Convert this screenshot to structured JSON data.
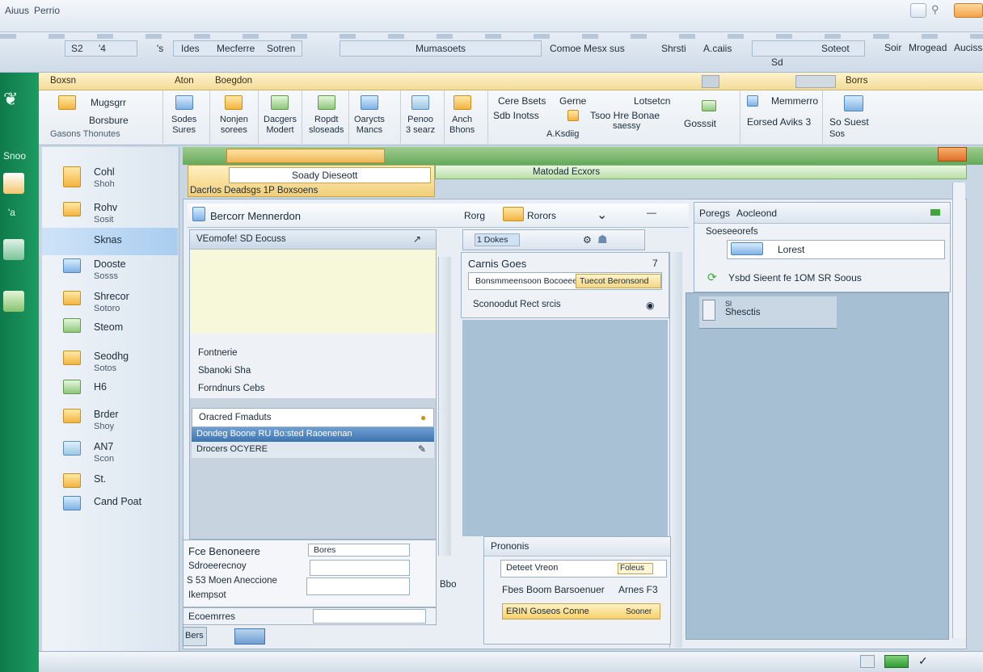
{
  "titlebar": {
    "items": [
      "Aiuus",
      "Perrio"
    ]
  },
  "menu": {
    "items": [
      "S2",
      "'4",
      "'s",
      "Ides",
      "Mecferre",
      "Sotren",
      "Mumasoets",
      "Comoe Mesx sus",
      "Shrsti",
      "A.caiis",
      "Sd",
      "Soteot",
      "Soir",
      "Mrogead",
      "Auciss"
    ]
  },
  "ribbon": {
    "tabs": [
      "Boxsn",
      "Aton",
      "Boegdon",
      "Borrs"
    ],
    "groups": [
      {
        "label": "Mugsgrr",
        "sub": "Borsbure",
        "foot": "Gasons   Thonutes"
      },
      {
        "label": "Sodes",
        "sub": "Sures"
      },
      {
        "label": "Nonjen",
        "sub": "sorees"
      },
      {
        "label": "Dacgers",
        "sub": "Modert"
      },
      {
        "label": "Ropdt",
        "sub": "sloseads"
      },
      {
        "label": "Oarycts",
        "sub": "Mancs"
      },
      {
        "label": "Penoo",
        "sub": "3 searz"
      },
      {
        "label": "Anch",
        "sub": "Bhons"
      },
      {
        "label": "Cere Bsets",
        "sub": "Sdb Inotss"
      },
      {
        "label": "Gerne",
        "sub": "Tsoo Hre Bonae"
      },
      {
        "label": "Lotsetcn",
        "sub": "saessy"
      },
      {
        "label": "Gosssit",
        "sub": "A.Ksdiig"
      },
      {
        "label": "Memmerro",
        "sub": "Eorsed Aviks 3"
      },
      {
        "label": "So Suest",
        "sub": "Sos"
      }
    ]
  },
  "rail": {
    "labels": [
      "Snoo",
      "'a"
    ]
  },
  "nav": {
    "items": [
      {
        "l1": "Cohl",
        "l2": "Shoh"
      },
      {
        "l1": "Rohv",
        "l2": "Sosit"
      },
      {
        "l1": "Sknas",
        "l2": ""
      },
      {
        "l1": "Dooste",
        "l2": "Sosss"
      },
      {
        "l1": "Shrecor",
        "l2": "Sotoro"
      },
      {
        "l1": "Steom",
        "l2": ""
      },
      {
        "l1": "Seodhg",
        "l2": "Sotos"
      },
      {
        "l1": "H6",
        "l2": ""
      },
      {
        "l1": "Brder",
        "l2": "Shoy"
      },
      {
        "l1": "AN7",
        "l2": "Scon"
      },
      {
        "l1": "St.",
        "l2": ""
      },
      {
        "l1": "Cand Poat",
        "l2": ""
      }
    ]
  },
  "doc": {
    "tab1": "Soady Dieseott",
    "tab2": "Matodad Ecxors",
    "yellowbar": "Dacrlos Deadsgs 1P Boxsoens",
    "header": "Bercorr Mennerdon",
    "rbtn": "Rorg",
    "rlabel": "Rorors"
  },
  "left": {
    "search": "VEomofe! SD Eocuss",
    "lines": [
      "Fontnerie",
      "Sbanoki Sha",
      "Forndnurs  Cebs"
    ],
    "group": "Oracred Fmaduts",
    "row_sel": "Dondeg Boone RU Bo:sted Raoenenan",
    "row2": "Drocers OCYERE",
    "form_title": "Fce Benoneere",
    "form_lines": [
      "Sdroeerecnoy",
      "S 53 Moen Aneccione",
      "Ikempsot"
    ],
    "combo": "Bores",
    "foot": "Ecoemrres",
    "status": "Bers"
  },
  "mid": {
    "search": "1 Dokes",
    "title": "Carnis Goes",
    "q": "7",
    "field": "Bonsmmeensoon Bocoeee",
    "field2": "Tuecot Beronsond",
    "row": "Sconoodut  Rect srcis",
    "side_labels": [
      "Bbo"
    ],
    "bottom_title": "Prononis",
    "bf1": "Deteet Vreon",
    "bf1b": "Foleus",
    "bf2": "Fbes Boom Barsoenuer",
    "bf2b": "Arnes F3",
    "bf3": "ERIN Goseos Conne",
    "bf3b": "Sooner"
  },
  "right": {
    "tab": "Poregs",
    "title": "Aocleond",
    "sub": "Soeseeorefs",
    "field": "Lorest",
    "row": "Ysbd Sieent  fe 1OM SR Soous",
    "item": "Shesctis",
    "item_sub": "Sl"
  }
}
